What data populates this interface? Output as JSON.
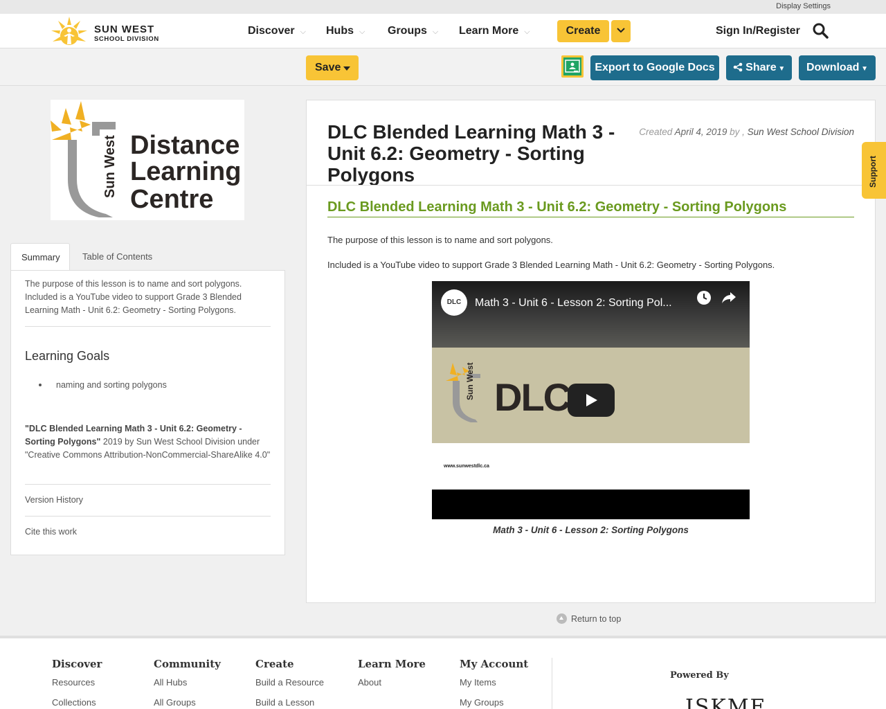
{
  "top": {
    "display_settings": "Display Settings"
  },
  "brand": {
    "name_line1": "SUN WEST",
    "name_line2": "SCHOOL DIVISION"
  },
  "nav": {
    "items": [
      {
        "label": "Discover"
      },
      {
        "label": "Hubs"
      },
      {
        "label": "Groups"
      },
      {
        "label": "Learn More"
      }
    ],
    "create": "Create",
    "signin": "Sign In/Register"
  },
  "toolbar": {
    "save": "Save",
    "export": "Export to Google Docs",
    "share": "Share",
    "download": "Download"
  },
  "sidebar": {
    "logo_text": {
      "side": "Sun West",
      "l1": "Distance",
      "l2": "Learning",
      "l3": "Centre"
    },
    "tabs": [
      "Summary",
      "Table of Contents"
    ],
    "summary": "The purpose of this lesson is to name and sort polygons. Included is a YouTube video to support Grade 3 Blended Learning Math - Unit 6.2: Geometry - Sorting Polygons.",
    "learning_goals_title": "Learning Goals",
    "learning_goals": [
      "naming and sorting polygons"
    ],
    "attribution_title": "\"DLC Blended Learning Math 3 - Unit 6.2: Geometry - Sorting Polygons\"",
    "attribution_rest": " 2019 by Sun West School Division under \"Creative Commons Attribution-NonCommercial-ShareAlike 4.0\"",
    "version_history": "Version History",
    "cite": "Cite this work"
  },
  "main": {
    "title": "DLC Blended Learning Math 3 - Unit 6.2: Geometry - Sorting Polygons",
    "created_label": "Created",
    "created_date": "April 4, 2019",
    "by": "by ,",
    "author": "Sun West School Division",
    "section_heading": "DLC Blended Learning Math 3 - Unit 6.2: Geometry - Sorting Polygons",
    "para1": "The purpose of this lesson is to name and sort polygons.",
    "para2": "Included is a YouTube video to support Grade 3 Blended Learning Math - Unit 6.2: Geometry - Sorting Polygons.",
    "video": {
      "title": "Math 3 - Unit 6 - Lesson 2: Sorting Pol...",
      "channel": "DLC",
      "logo_big": "DLC",
      "logo_side": "Sun West",
      "url": "www.sunwestdlc.ca"
    },
    "caption": "Math 3 - Unit 6 - Lesson 2: Sorting Polygons"
  },
  "return_top": "Return to top",
  "support": "Support",
  "footer": {
    "columns": [
      {
        "head": "Discover",
        "links": [
          "Resources",
          "Collections"
        ]
      },
      {
        "head": "Community",
        "links": [
          "All Hubs",
          "All Groups"
        ]
      },
      {
        "head": "Create",
        "links": [
          "Build a Resource",
          "Build a Lesson"
        ]
      },
      {
        "head": "Learn More",
        "links": [
          "About"
        ]
      },
      {
        "head": "My Account",
        "links": [
          "My Items",
          "My Groups"
        ]
      }
    ],
    "powered_by": "Powered By",
    "iskme": "ISKME"
  },
  "colors": {
    "accent_yellow": "#f8c436",
    "button_blue": "#1e6c8c",
    "link_green": "#6a9a1f"
  }
}
